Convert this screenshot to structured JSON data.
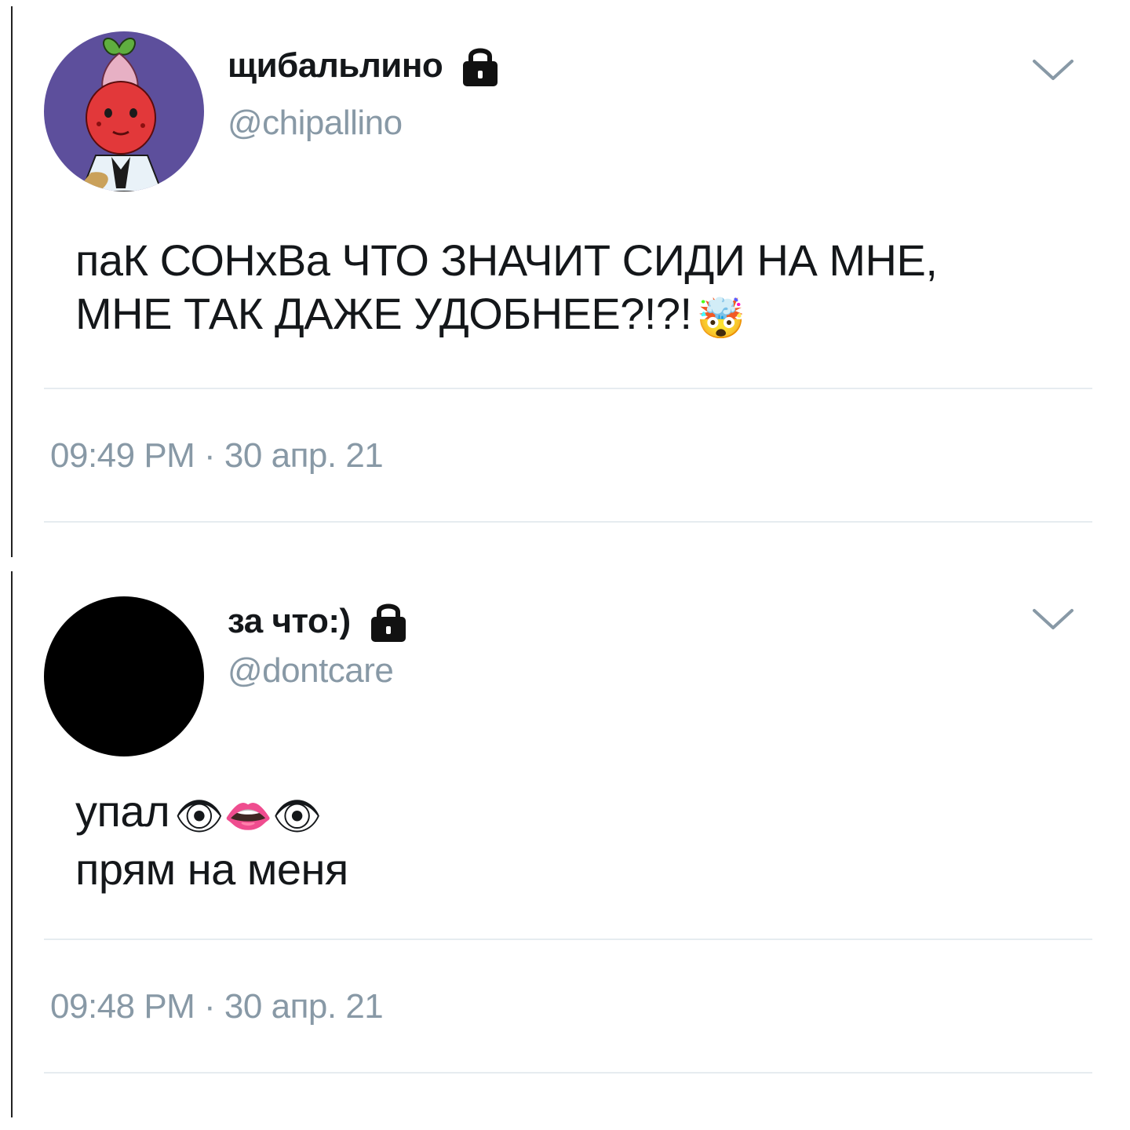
{
  "tweets": [
    {
      "display_name": "щибальлино",
      "handle": "@chipallino",
      "text_lines": [
        "паК СОНхВа ЧТО ЗНАЧИТ СИДИ НА МНЕ,",
        "МНЕ ТАК ДАЖЕ УДОБНЕЕ?!?!"
      ],
      "emoji_line2": "🤯",
      "timestamp": "09:49 PM · 30 апр. 21",
      "avatar": "cartoon-character-avatar",
      "lock": "lock-icon"
    },
    {
      "display_name": "за что:)",
      "handle": "@dontcare",
      "text_lines": [
        "упал",
        "прям на меня"
      ],
      "emoji_line1": "👁👄👁",
      "timestamp": "09:48 PM · 30 апр. 21",
      "avatar": "black-avatar",
      "lock": "lock-icon"
    }
  ],
  "colors": {
    "name": "#14171a",
    "secondary": "#8899a6",
    "divider": "#e6ecf0",
    "avatar_bg": "#5d4f9c",
    "avatar_face": "#e2383a"
  }
}
